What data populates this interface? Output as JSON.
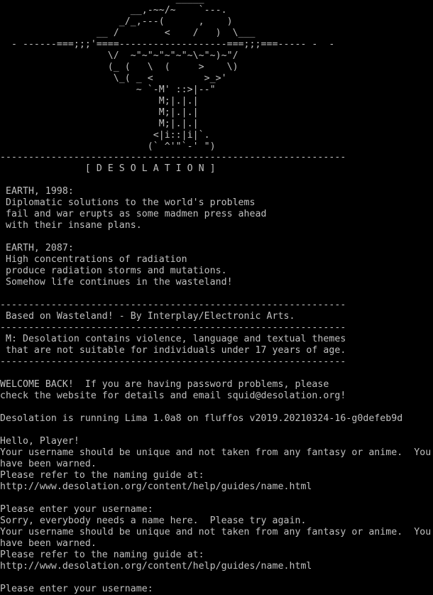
{
  "terminal": {
    "background": "#000000",
    "foreground": "#c0c0c0",
    "art_lines": [
      "                               _____",
      "                       __,-~~/~    `---.",
      "                     _/_,---(      ,    )",
      "                 __ /        <    /   )  \\___",
      "  - ------===;;;'====-------------------===;;;===----- -  -",
      "                   \\/  ~\"~\"~\"~\"~\"~\\~\"~)~\"/",
      "                   (_ (   \\  (     >    \\)",
      "                    \\_( _ <         >_>'",
      "                        ~ `-M' ::>|--\"",
      "                            M;|.|.|",
      "                            M;|.|.|",
      "                            M;|.|.|",
      "                           <|i::|i|`.",
      "                          (` ^'\"`-' \")"
    ],
    "body_lines": [
      "-------------------------------------------------------------",
      "               [ D E S O L A T I O N ]",
      "",
      " EARTH, 1998:",
      " Diplomatic solutions to the world's problems",
      " fail and war erupts as some madmen press ahead",
      " with their insane plans.",
      "",
      " EARTH, 2087:",
      " High concentrations of radiation",
      " produce radiation storms and mutations.",
      " Somehow life continues in the wasteland!",
      "",
      "-------------------------------------------------------------",
      " Based on Wasteland! - By Interplay/Electronic Arts.",
      "-------------------------------------------------------------",
      " M: Desolation contains violence, language and textual themes",
      " that are not suitable for individuals under 17 years of age.",
      "-------------------------------------------------------------",
      "",
      "WELCOME BACK!  If you are having password problems, please",
      "check the website for details and email squid@desolation.org!",
      "",
      "Desolation is running Lima 1.0a8 on fluffos v2019.20210324-16-g0defeb9d",
      "",
      "Hello, Player!",
      "Your username should be unique and not taken from any fantasy or anime.  You",
      "have been warned.",
      "Please refer to the naming guide at:",
      "http://www.desolation.org/content/help/guides/name.html",
      "",
      "Please enter your username:",
      "Sorry, everybody needs a name here.  Please try again.",
      "Your username should be unique and not taken from any fantasy or anime.  You",
      "have been warned.",
      "Please refer to the naming guide at:",
      "http://www.desolation.org/content/help/guides/name.html",
      "",
      "Please enter your username: "
    ]
  }
}
